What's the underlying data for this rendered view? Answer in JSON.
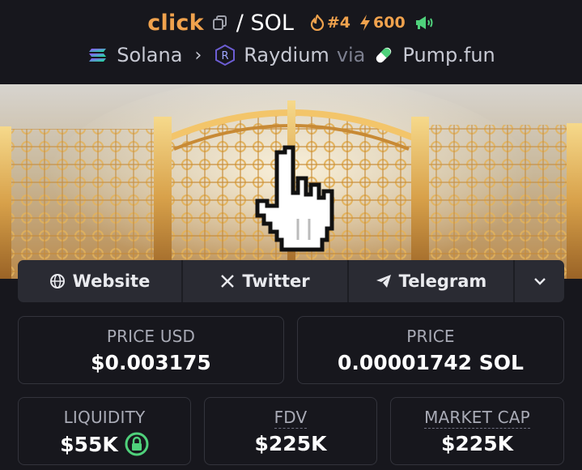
{
  "token": {
    "symbol": "click",
    "quote": "/ SOL",
    "rank": "#4",
    "boosts": "600"
  },
  "route": {
    "chain": "Solana",
    "dex": "Raydium",
    "via": "via",
    "launchpad": "Pump.fun"
  },
  "links": {
    "website": "Website",
    "twitter": "Twitter",
    "telegram": "Telegram"
  },
  "stats": {
    "price_usd_label": "PRICE USD",
    "price_usd": "$0.003175",
    "price_label": "PRICE",
    "price_native": "0.00001742 SOL",
    "liquidity_label": "LIQUIDITY",
    "liquidity": "$55K",
    "fdv_label": "FDV",
    "fdv": "$225K",
    "mcap_label": "MARKET CAP",
    "mcap": "$225K"
  },
  "icons": {
    "copy": "copy-icon",
    "rank": "flame-icon",
    "boost": "lightning-icon",
    "promo": "megaphone-icon",
    "chain": "solana-icon",
    "dex": "raydium-icon",
    "launchpad": "pill-icon",
    "website": "globe-icon",
    "twitter": "x-icon",
    "telegram": "telegram-icon",
    "more": "chevron-down-icon",
    "liquidity": "lock-icon"
  },
  "colors": {
    "accent": "#f0a24d",
    "background": "#17171d",
    "button_bg": "#2a2b33",
    "lock_green": "#4fd17b"
  }
}
